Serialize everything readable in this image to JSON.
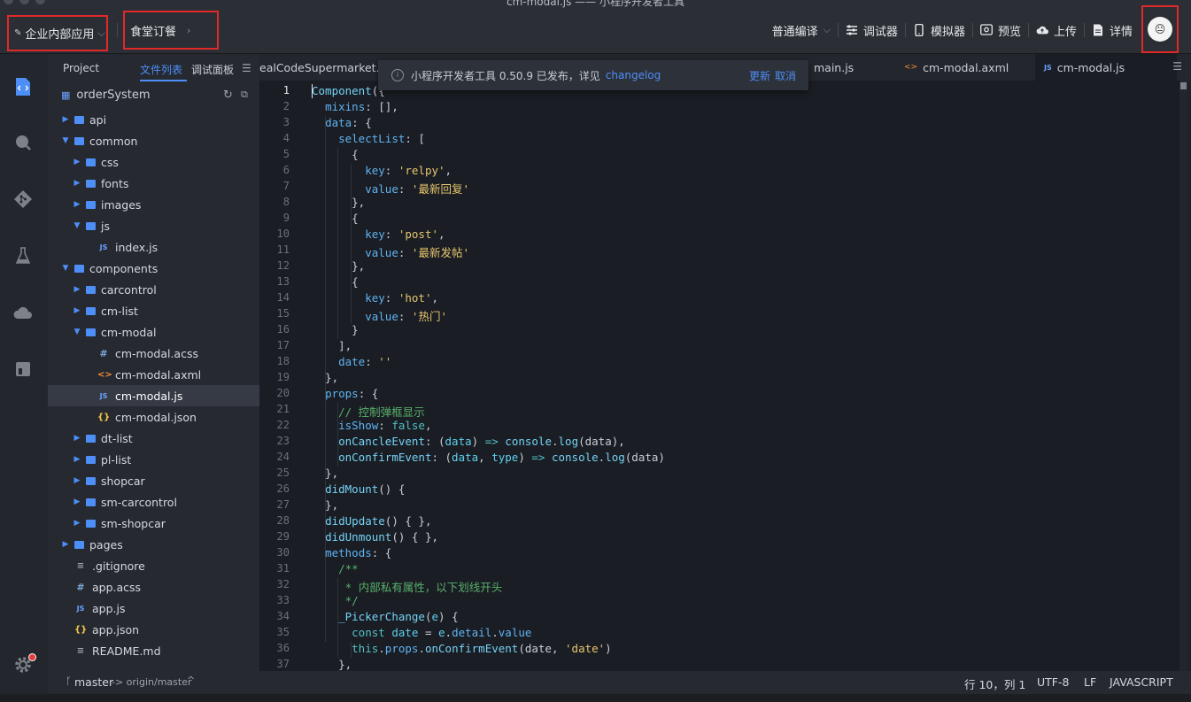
{
  "window": {
    "title": "cm-modal.js —— 小程序开发者工具"
  },
  "toolbar": {
    "project_selector": "企业内部应用",
    "app_selector": "食堂订餐",
    "compile_mode": "普通编译",
    "debugger": "调试器",
    "simulator": "模拟器",
    "preview": "预览",
    "upload": "上传",
    "details": "详情",
    "avatar_text": "😐"
  },
  "explorer": {
    "tabs": {
      "project": "Project",
      "files": "文件列表",
      "debug_panel": "调试面板"
    },
    "root": "orderSystem",
    "items": [
      {
        "label": "api",
        "type": "folder",
        "depth": 1,
        "open": false
      },
      {
        "label": "common",
        "type": "folder",
        "depth": 1,
        "open": true
      },
      {
        "label": "css",
        "type": "folder",
        "depth": 2,
        "open": false
      },
      {
        "label": "fonts",
        "type": "folder",
        "depth": 2,
        "open": false
      },
      {
        "label": "images",
        "type": "folder",
        "depth": 2,
        "open": false
      },
      {
        "label": "js",
        "type": "folder",
        "depth": 2,
        "open": true
      },
      {
        "label": "index.js",
        "type": "js",
        "depth": 3
      },
      {
        "label": "components",
        "type": "folder",
        "depth": 1,
        "open": true
      },
      {
        "label": "carcontrol",
        "type": "folder",
        "depth": 2,
        "open": false
      },
      {
        "label": "cm-list",
        "type": "folder",
        "depth": 2,
        "open": false
      },
      {
        "label": "cm-modal",
        "type": "folder",
        "depth": 2,
        "open": true
      },
      {
        "label": "cm-modal.acss",
        "type": "acss",
        "depth": 3
      },
      {
        "label": "cm-modal.axml",
        "type": "axml",
        "depth": 3
      },
      {
        "label": "cm-modal.js",
        "type": "js",
        "depth": 3,
        "active": true
      },
      {
        "label": "cm-modal.json",
        "type": "json",
        "depth": 3
      },
      {
        "label": "dt-list",
        "type": "folder",
        "depth": 2,
        "open": false
      },
      {
        "label": "pl-list",
        "type": "folder",
        "depth": 2,
        "open": false
      },
      {
        "label": "shopcar",
        "type": "folder",
        "depth": 2,
        "open": false
      },
      {
        "label": "sm-carcontrol",
        "type": "folder",
        "depth": 2,
        "open": false
      },
      {
        "label": "sm-shopcar",
        "type": "folder",
        "depth": 2,
        "open": false
      },
      {
        "label": "pages",
        "type": "folder",
        "depth": 1,
        "open": false
      },
      {
        "label": ".gitignore",
        "type": "text",
        "depth": 1
      },
      {
        "label": "app.acss",
        "type": "acss",
        "depth": 1
      },
      {
        "label": "app.js",
        "type": "js",
        "depth": 1
      },
      {
        "label": "app.json",
        "type": "json",
        "depth": 1
      },
      {
        "label": "README.md",
        "type": "text",
        "depth": 1
      }
    ]
  },
  "editor_tabs": [
    {
      "label": "ealCodeSupermarket.js",
      "icon": ""
    },
    {
      "label": "main.js",
      "icon": ""
    },
    {
      "label": "cm-modal.axml",
      "icon": "<>"
    },
    {
      "label": "cm-modal.js",
      "icon": "JS",
      "active": true
    }
  ],
  "notification": {
    "message": "小程序开发者工具 0.50.9 已发布，详见",
    "link": "changelog",
    "update": "更新",
    "cancel": "取消"
  },
  "code": [
    [
      [
        "fn",
        "Component"
      ],
      [
        "p",
        "({"
      ]
    ],
    [
      [
        "p",
        "  "
      ],
      [
        "key",
        "mixins"
      ],
      [
        "p",
        ": [],"
      ]
    ],
    [
      [
        "p",
        "  "
      ],
      [
        "key",
        "data"
      ],
      [
        "p",
        ": {"
      ]
    ],
    [
      [
        "p",
        "    "
      ],
      [
        "key",
        "selectList"
      ],
      [
        "p",
        ": ["
      ]
    ],
    [
      [
        "p",
        "      {"
      ]
    ],
    [
      [
        "p",
        "        "
      ],
      [
        "key",
        "key"
      ],
      [
        "p",
        ": "
      ],
      [
        "str",
        "'relpy'"
      ],
      [
        "p",
        ","
      ]
    ],
    [
      [
        "p",
        "        "
      ],
      [
        "key",
        "value"
      ],
      [
        "p",
        ": "
      ],
      [
        "str",
        "'最新回复'"
      ]
    ],
    [
      [
        "p",
        "      },"
      ]
    ],
    [
      [
        "p",
        "      {"
      ]
    ],
    [
      [
        "p",
        "        "
      ],
      [
        "key",
        "key"
      ],
      [
        "p",
        ": "
      ],
      [
        "str",
        "'post'"
      ],
      [
        "p",
        ","
      ]
    ],
    [
      [
        "p",
        "        "
      ],
      [
        "key",
        "value"
      ],
      [
        "p",
        ": "
      ],
      [
        "str",
        "'最新发帖'"
      ]
    ],
    [
      [
        "p",
        "      },"
      ]
    ],
    [
      [
        "p",
        "      {"
      ]
    ],
    [
      [
        "p",
        "        "
      ],
      [
        "key",
        "key"
      ],
      [
        "p",
        ": "
      ],
      [
        "str",
        "'hot'"
      ],
      [
        "p",
        ","
      ]
    ],
    [
      [
        "p",
        "        "
      ],
      [
        "key",
        "value"
      ],
      [
        "p",
        ": "
      ],
      [
        "str",
        "'热门'"
      ]
    ],
    [
      [
        "p",
        "      }"
      ]
    ],
    [
      [
        "p",
        "    ],"
      ]
    ],
    [
      [
        "p",
        "    "
      ],
      [
        "key",
        "date"
      ],
      [
        "p",
        ": "
      ],
      [
        "str",
        "''"
      ]
    ],
    [
      [
        "p",
        "  },"
      ]
    ],
    [
      [
        "p",
        "  "
      ],
      [
        "key",
        "props"
      ],
      [
        "p",
        ": {"
      ]
    ],
    [
      [
        "p",
        "    "
      ],
      [
        "com",
        "// 控制弹框显示"
      ]
    ],
    [
      [
        "p",
        "    "
      ],
      [
        "key",
        "isShow"
      ],
      [
        "p",
        ": "
      ],
      [
        "kw",
        "false"
      ],
      [
        "p",
        ","
      ]
    ],
    [
      [
        "p",
        "    "
      ],
      [
        "fn",
        "onCancleEvent"
      ],
      [
        "p",
        ": ("
      ],
      [
        "var",
        "data"
      ],
      [
        "p",
        ") "
      ],
      [
        "kw",
        "=>"
      ],
      [
        "p",
        " "
      ],
      [
        "fn",
        "console"
      ],
      [
        "p",
        "."
      ],
      [
        "fn",
        "log"
      ],
      [
        "p",
        "(data),"
      ]
    ],
    [
      [
        "p",
        "    "
      ],
      [
        "fn",
        "onConfirmEvent"
      ],
      [
        "p",
        ": ("
      ],
      [
        "var",
        "data"
      ],
      [
        "p",
        ", "
      ],
      [
        "var",
        "type"
      ],
      [
        "p",
        ") "
      ],
      [
        "kw",
        "=>"
      ],
      [
        "p",
        " "
      ],
      [
        "fn",
        "console"
      ],
      [
        "p",
        "."
      ],
      [
        "fn",
        "log"
      ],
      [
        "p",
        "(data)"
      ]
    ],
    [
      [
        "p",
        "  },"
      ]
    ],
    [
      [
        "p",
        "  "
      ],
      [
        "fn",
        "didMount"
      ],
      [
        "p",
        "() {"
      ]
    ],
    [
      [
        "p",
        "  },"
      ]
    ],
    [
      [
        "p",
        "  "
      ],
      [
        "fn",
        "didUpdate"
      ],
      [
        "p",
        "() { },"
      ]
    ],
    [
      [
        "p",
        "  "
      ],
      [
        "fn",
        "didUnmount"
      ],
      [
        "p",
        "() { },"
      ]
    ],
    [
      [
        "p",
        "  "
      ],
      [
        "key",
        "methods"
      ],
      [
        "p",
        ": {"
      ]
    ],
    [
      [
        "p",
        "    "
      ],
      [
        "com",
        "/**"
      ]
    ],
    [
      [
        "p",
        "     "
      ],
      [
        "com",
        "* 内部私有属性，以下划线开头"
      ]
    ],
    [
      [
        "p",
        "     "
      ],
      [
        "com",
        "*/"
      ]
    ],
    [
      [
        "p",
        "    "
      ],
      [
        "fn",
        "_PickerChange"
      ],
      [
        "p",
        "("
      ],
      [
        "var",
        "e"
      ],
      [
        "p",
        ") {"
      ]
    ],
    [
      [
        "p",
        "      "
      ],
      [
        "kw",
        "const"
      ],
      [
        "p",
        " "
      ],
      [
        "var",
        "date"
      ],
      [
        "p",
        " = "
      ],
      [
        "var",
        "e"
      ],
      [
        "p",
        "."
      ],
      [
        "key",
        "detail"
      ],
      [
        "p",
        "."
      ],
      [
        "key",
        "value"
      ]
    ],
    [
      [
        "p",
        "      "
      ],
      [
        "kw",
        "this"
      ],
      [
        "p",
        "."
      ],
      [
        "key",
        "props"
      ],
      [
        "p",
        "."
      ],
      [
        "fn",
        "onConfirmEvent"
      ],
      [
        "p",
        "(date, "
      ],
      [
        "str",
        "'date'"
      ],
      [
        "p",
        ")"
      ]
    ],
    [
      [
        "p",
        "    },"
      ]
    ]
  ],
  "statusbar": {
    "branch": "master",
    "remote": "-> origin/master",
    "position": "行 10，列 1",
    "encoding": "UTF-8",
    "eol": "LF",
    "language": "JAVASCRIPT"
  },
  "colors": {
    "accent": "#4e8ef7",
    "highlight_border": "#e02a2a",
    "string": "#e7c66f",
    "comment": "#58b06a"
  }
}
